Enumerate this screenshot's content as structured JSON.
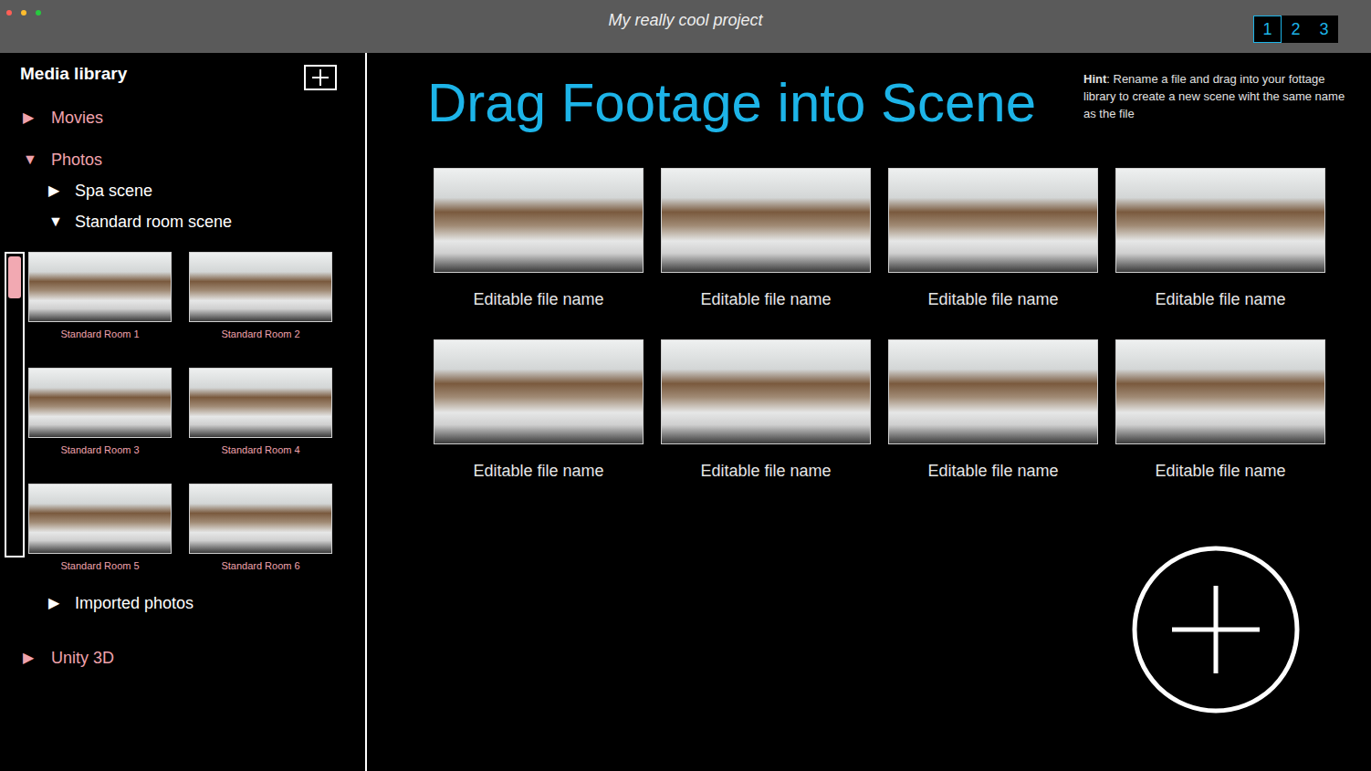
{
  "window": {
    "title": "My really cool project",
    "controls": [
      {
        "color": "#ff5f56"
      },
      {
        "color": "#ffbd2e"
      },
      {
        "color": "#27c93f"
      }
    ]
  },
  "pages": [
    {
      "label": "1",
      "selected": true
    },
    {
      "label": "2",
      "selected": false
    },
    {
      "label": "3",
      "selected": false
    }
  ],
  "sidebar": {
    "title": "Media library",
    "items": [
      {
        "arrow": "▶",
        "label": "Movies",
        "expanded": false
      },
      {
        "arrow": "▼",
        "label": "Photos",
        "expanded": true,
        "children": [
          {
            "arrow": "▶",
            "label": "Spa scene",
            "expanded": false
          },
          {
            "arrow": "▼",
            "label": "Standard room scene",
            "expanded": true,
            "scrollbar": {
              "level": 0.14
            },
            "thumbnails": [
              {
                "caption": "Standard Room 1"
              },
              {
                "caption": "Standard Room 2"
              },
              {
                "caption": "Standard Room 3"
              },
              {
                "caption": "Standard Room 4"
              },
              {
                "caption": "Standard Room 5"
              },
              {
                "caption": "Standard Room 6"
              }
            ]
          },
          {
            "arrow": "▶",
            "label": "Imported photos",
            "expanded": false
          }
        ]
      },
      {
        "arrow": "▶",
        "label": "Unity 3D",
        "expanded": false
      }
    ]
  },
  "main": {
    "heading": "Drag Footage into Scene",
    "hint": {
      "label": "Hint",
      "text": ": Rename a file and drag into your fottage library to create a new scene wiht the same name as the file"
    },
    "tiles": [
      {
        "name": "Editable file name"
      },
      {
        "name": "Editable file name"
      },
      {
        "name": "Editable file name"
      },
      {
        "name": "Editable file name"
      },
      {
        "name": "Editable file name"
      },
      {
        "name": "Editable file name"
      },
      {
        "name": "Editable file name"
      },
      {
        "name": "Editable file name"
      }
    ]
  }
}
